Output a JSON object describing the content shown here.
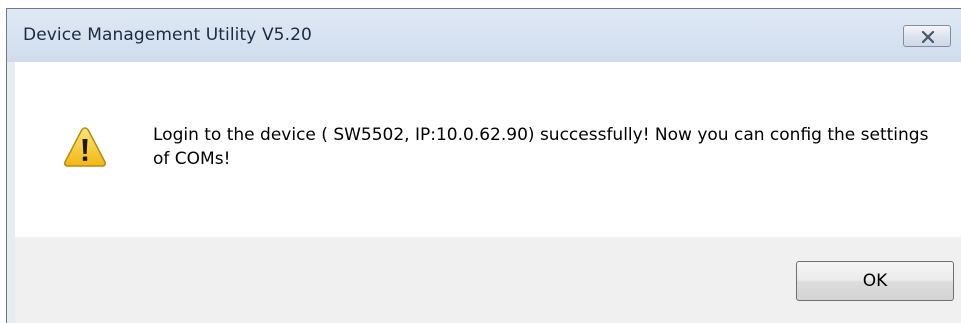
{
  "window": {
    "title": "Device Management Utility V5.20"
  },
  "dialog": {
    "icon": "warning-icon",
    "message": "Login to the device ( SW5502,  IP:10.0.62.90) successfully! Now you can config the settings of COMs!",
    "ok_label": "OK"
  },
  "colors": {
    "titlebar": "#d6e2f0",
    "content_bg": "#ffffff",
    "footer_bg": "#f0f0f0",
    "warning_yellow": "#f6c529"
  }
}
